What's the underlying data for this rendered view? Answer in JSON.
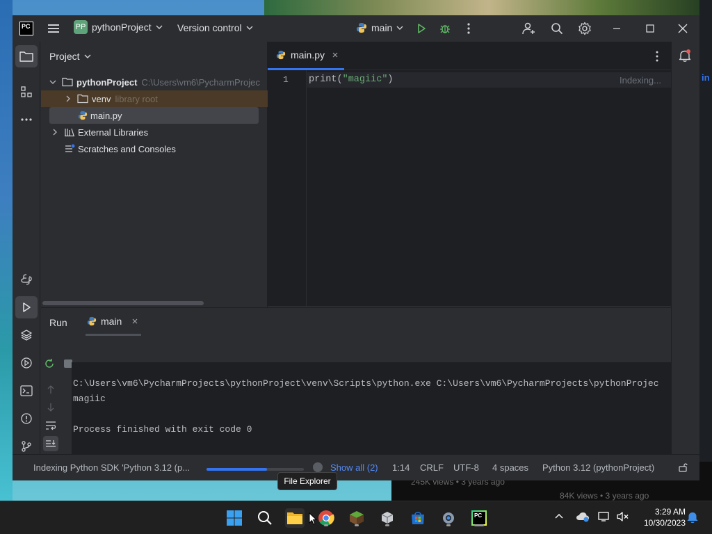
{
  "window": {
    "logo": "PC",
    "project_badge": "PP",
    "project_name": "pythonProject",
    "vcs_label": "Version control",
    "run_config": "main"
  },
  "project_panel": {
    "title": "Project",
    "tree": [
      {
        "label": "pythonProject",
        "hint": "C:\\Users\\vm6\\PycharmProjec"
      },
      {
        "label": "venv",
        "hint": "library root"
      },
      {
        "label": "main.py",
        "hint": ""
      },
      {
        "label": "External Libraries",
        "hint": ""
      },
      {
        "label": "Scratches and Consoles",
        "hint": ""
      }
    ]
  },
  "editor": {
    "tab_label": "main.py",
    "line_number": "1",
    "code_fn": "print(",
    "code_str": "\"magiic\"",
    "code_close": ")",
    "indexing_label": "Indexing..."
  },
  "run_panel": {
    "title": "Run",
    "tab_label": "main",
    "console_lines": [
      "C:\\Users\\vm6\\PycharmProjects\\pythonProject\\venv\\Scripts\\python.exe C:\\Users\\vm6\\PycharmProjects\\pythonProjec",
      "magiic",
      "",
      "Process finished with exit code 0"
    ]
  },
  "status_bar": {
    "indexing_text": "Indexing Python SDK 'Python 3.12 (p...",
    "indexing_progress": 0.62,
    "show_all": "Show all (2)",
    "caret": "1:14",
    "line_sep": "CRLF",
    "encoding": "UTF-8",
    "indent": "4 spaces",
    "interpreter": "Python 3.12 (pythonProject)"
  },
  "tooltip": "File Explorer",
  "desktop": {
    "ghost_views_1": "245K views • 3 years ago",
    "ghost_views_2": "84K views • 3 years ago",
    "edge_text": "in"
  },
  "taskbar": {
    "time": "3:29 AM",
    "date": "10/30/2023"
  },
  "colors": {
    "accent": "#3574f0",
    "run_green": "#5fb865",
    "python_yellow": "#f2c55c",
    "python_blue": "#3f7bc0",
    "string_green": "#6aab73"
  }
}
